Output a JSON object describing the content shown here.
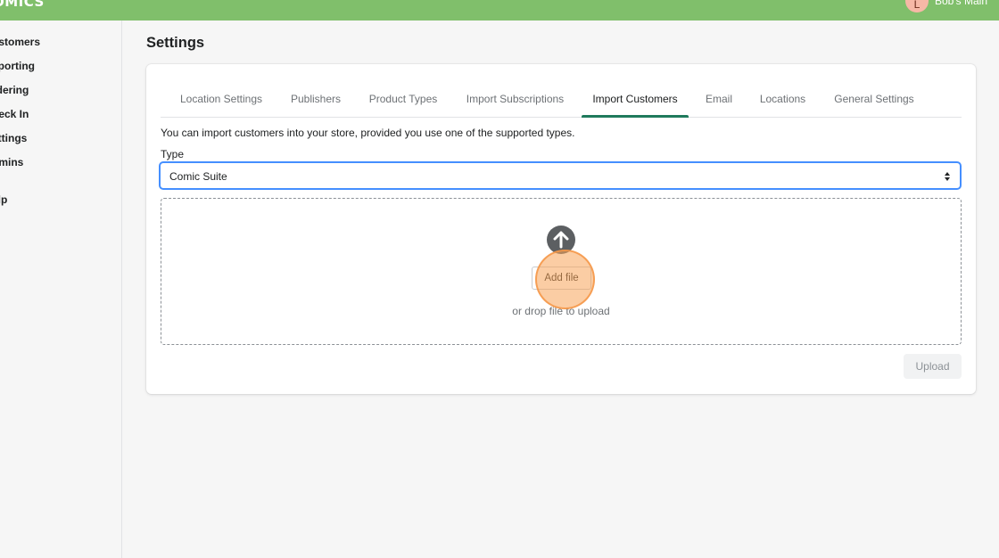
{
  "header": {
    "logo": "OMICS",
    "avatar_initial": "L",
    "store_name": "Bob's Main"
  },
  "sidebar": {
    "items": [
      {
        "label": "ustomers"
      },
      {
        "label": "eporting"
      },
      {
        "label": "rdering"
      },
      {
        "label": "heck In"
      },
      {
        "label": "ettings"
      },
      {
        "label": "dmins"
      },
      {
        "label": "elp"
      }
    ]
  },
  "page": {
    "title": "Settings"
  },
  "tabs": [
    {
      "label": "Location Settings"
    },
    {
      "label": "Publishers"
    },
    {
      "label": "Product Types"
    },
    {
      "label": "Import Subscriptions"
    },
    {
      "label": "Import Customers",
      "active": true
    },
    {
      "label": "Email"
    },
    {
      "label": "Locations"
    },
    {
      "label": "General Settings"
    }
  ],
  "import": {
    "intro": "You can import customers into your store, provided you use one of the supported types.",
    "type_label": "Type",
    "type_value": "Comic Suite",
    "add_file_label": "Add file",
    "drop_hint": "or drop file to upload",
    "upload_label": "Upload"
  },
  "colors": {
    "topbar": "#80bf6b",
    "active_tab": "#1f7a5c",
    "focus": "#458fff"
  }
}
